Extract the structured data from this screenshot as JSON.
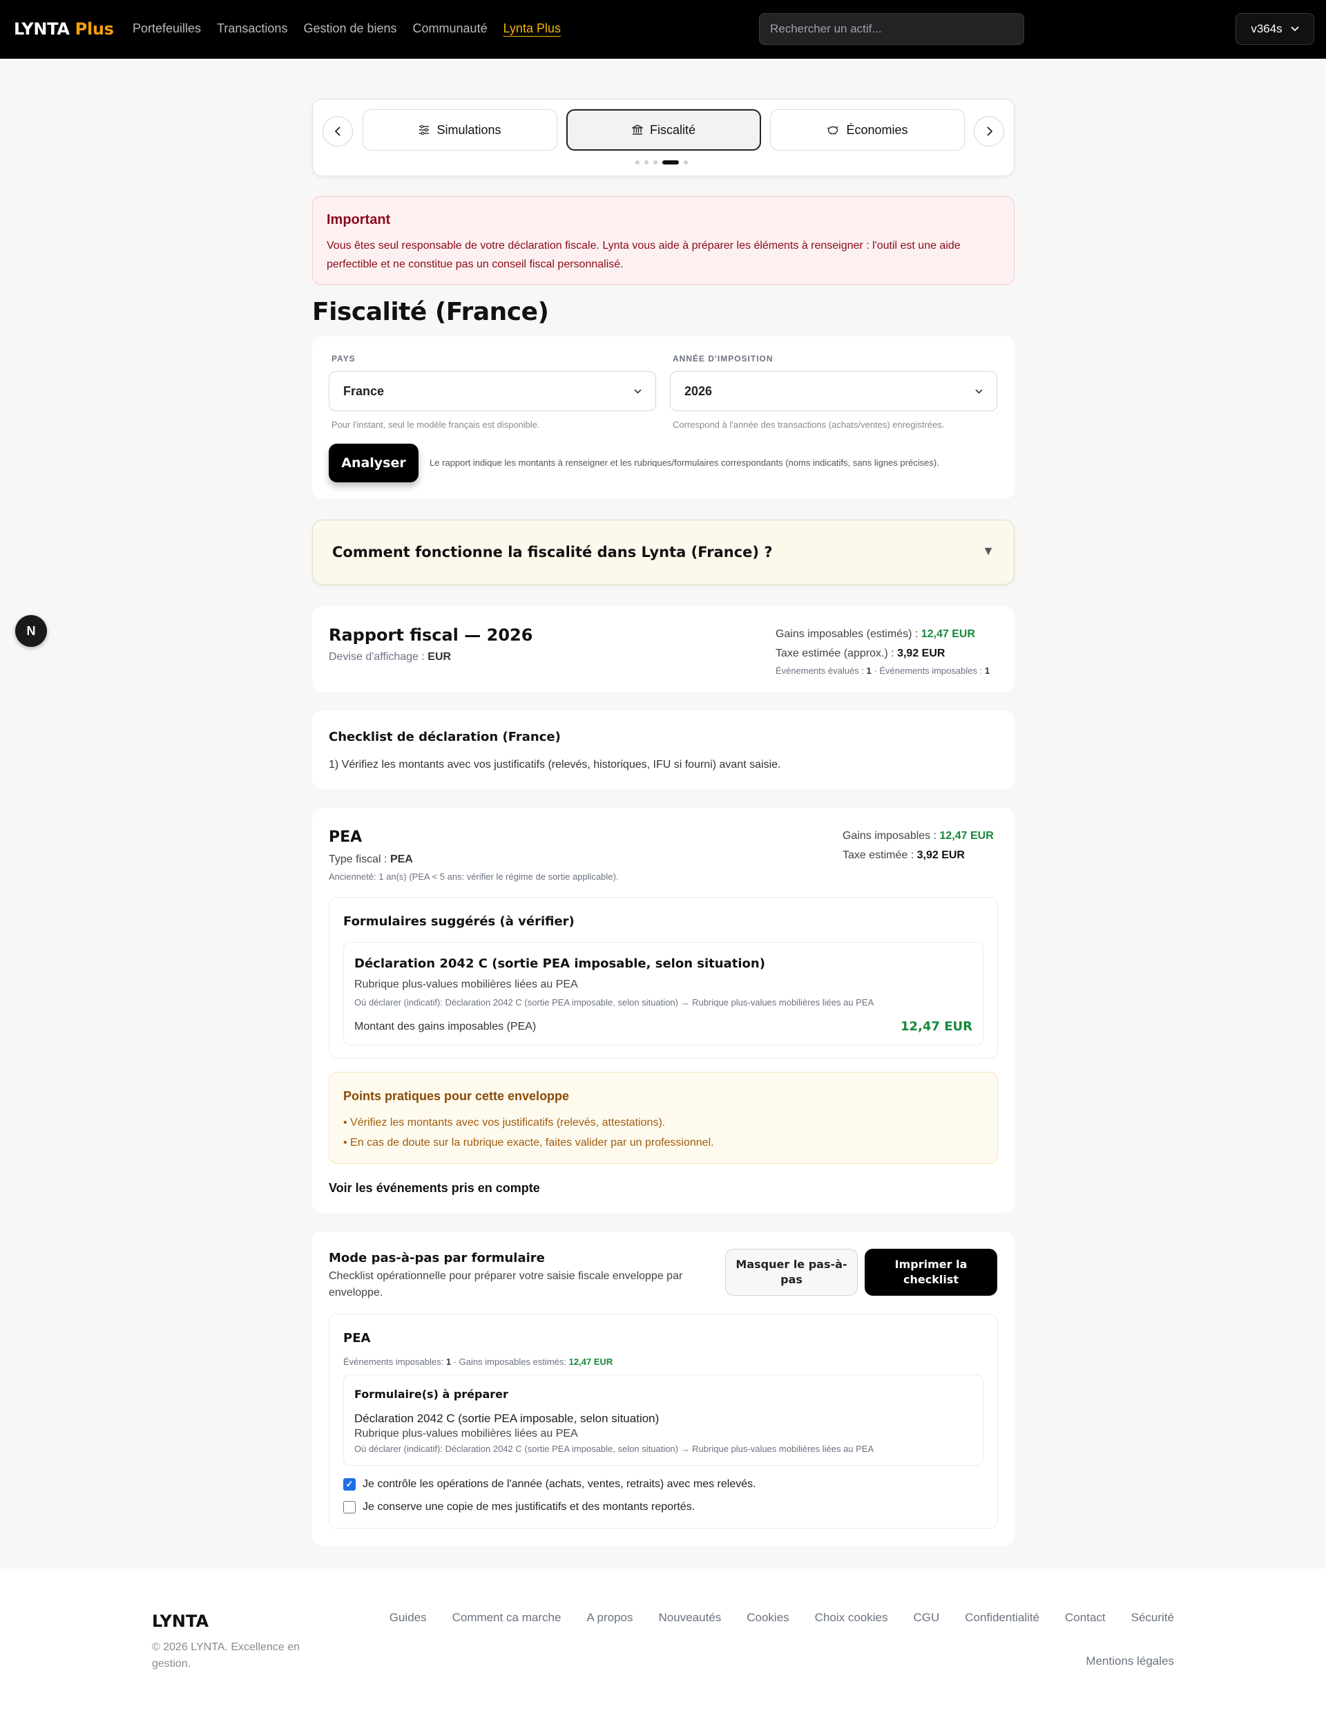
{
  "header": {
    "brand_main": "LYNTA",
    "brand_accent": "Plus",
    "nav": [
      "Portefeuilles",
      "Transactions",
      "Gestion de biens",
      "Communauté",
      "Lynta Plus"
    ],
    "search_placeholder": "Rechercher un actif...",
    "version": "v364s"
  },
  "tabs": {
    "items": [
      "Simulations",
      "Fiscalité",
      "Économies"
    ],
    "active": "Fiscalité"
  },
  "alert": {
    "title": "Important",
    "body": "Vous êtes seul responsable de votre déclaration fiscale. Lynta vous aide à préparer les éléments à renseigner : l'outil est une aide perfectible et ne constitue pas un conseil fiscal personnalisé."
  },
  "page_title": "Fiscalité (France)",
  "form": {
    "country_label": "PAYS",
    "country_value": "France",
    "country_hint": "Pour l'instant, seul le modèle français est disponible.",
    "year_label": "ANNÉE D'IMPOSITION",
    "year_value": "2026",
    "year_hint": "Correspond à l'année des transactions (achats/ventes) enregistrées.",
    "analyze_label": "Analyser",
    "analyze_hint": "Le rapport indique les montants à renseigner et les rubriques/formulaires correspondants (noms indicatifs, sans lignes précises)."
  },
  "accordion": {
    "title": "Comment fonctionne la fiscalité dans Lynta (France) ?"
  },
  "report": {
    "title": "Rapport fiscal — 2026",
    "currency_label": "Devise d'affichage :",
    "currency": "EUR",
    "gains_label": "Gains imposables (estimés) :",
    "gains": "12,47 EUR",
    "tax_label": "Taxe estimée (approx.) :",
    "tax": "3,92 EUR",
    "events_label": "Événements évalués :",
    "events": "1",
    "taxable_events_label": "· Événements imposables :",
    "taxable_events": "1"
  },
  "checklist": {
    "title": "Checklist de déclaration (France)",
    "item": "1) Vérifiez les montants avec vos justificatifs (relevés, historiques, IFU si fourni) avant saisie."
  },
  "pea": {
    "title": "PEA",
    "type_label": "Type fiscal :",
    "type": "PEA",
    "age": "Ancienneté: 1 an(s) (PEA < 5 ans: vérifier le régime de sortie applicable).",
    "gains_label": "Gains imposables :",
    "gains": "12,47 EUR",
    "tax_label": "Taxe estimée :",
    "tax": "3,92 EUR",
    "forms_title": "Formulaires suggérés (à vérifier)",
    "form_title": "Déclaration 2042 C (sortie PEA imposable, selon situation)",
    "form_sub": "Rubrique plus-values mobilières liées au PEA",
    "form_where": "Où déclarer (indicatif): Déclaration 2042 C (sortie PEA imposable, selon situation) → Rubrique plus-values mobilières liées au PEA",
    "amount_label": "Montant des gains imposables (PEA)",
    "amount": "12,47 EUR",
    "tips_title": "Points pratiques pour cette enveloppe",
    "tip1": "• Vérifiez les montants avec vos justificatifs (relevés, attestations).",
    "tip2": "• En cas de doute sur la rubrique exacte, faites valider par un professionnel.",
    "events_link": "Voir les événements pris en compte"
  },
  "step": {
    "title": "Mode pas-à-pas par formulaire",
    "subtitle": "Checklist opérationnelle pour préparer votre saisie fiscale enveloppe par enveloppe.",
    "hide_label": "Masquer le pas-à-pas",
    "print_label": "Imprimer la checklist",
    "env_title": "PEA",
    "env_meta_a": "Événements imposables:",
    "env_meta_events": "1",
    "env_meta_b": "· Gains imposables estimés:",
    "env_meta_gains": "12,47 EUR",
    "box_title": "Formulaire(s) à préparer",
    "box_l1": "Déclaration 2042 C (sortie PEA imposable, selon situation)",
    "box_l2": "Rubrique plus-values mobilières liées au PEA",
    "box_l3": "Où déclarer (indicatif): Déclaration 2042 C (sortie PEA imposable, selon situation) → Rubrique plus-values mobilières liées au PEA",
    "check1": "Je contrôle les opérations de l'année (achats, ventes, retraits) avec mes relevés.",
    "check1_checked": true,
    "check2": "Je conserve une copie de mes justificatifs et des montants reportés.",
    "check2_checked": false
  },
  "badge": "N",
  "footer": {
    "brand": "LYNTA",
    "copyright": "© 2026 LYNTA. Excellence en gestion.",
    "links": [
      "Guides",
      "Comment ca marche",
      "A propos",
      "Nouveautés",
      "Cookies",
      "Choix cookies",
      "CGU",
      "Confidentialité",
      "Contact",
      "Sécurité"
    ],
    "legal": "Mentions légales"
  },
  "colors": {
    "accent": "#f59e0b",
    "nav_active": "#f6b400",
    "positive": "#158a3a",
    "alert_text": "#8b0a1a",
    "check": "#1d6fe8"
  }
}
